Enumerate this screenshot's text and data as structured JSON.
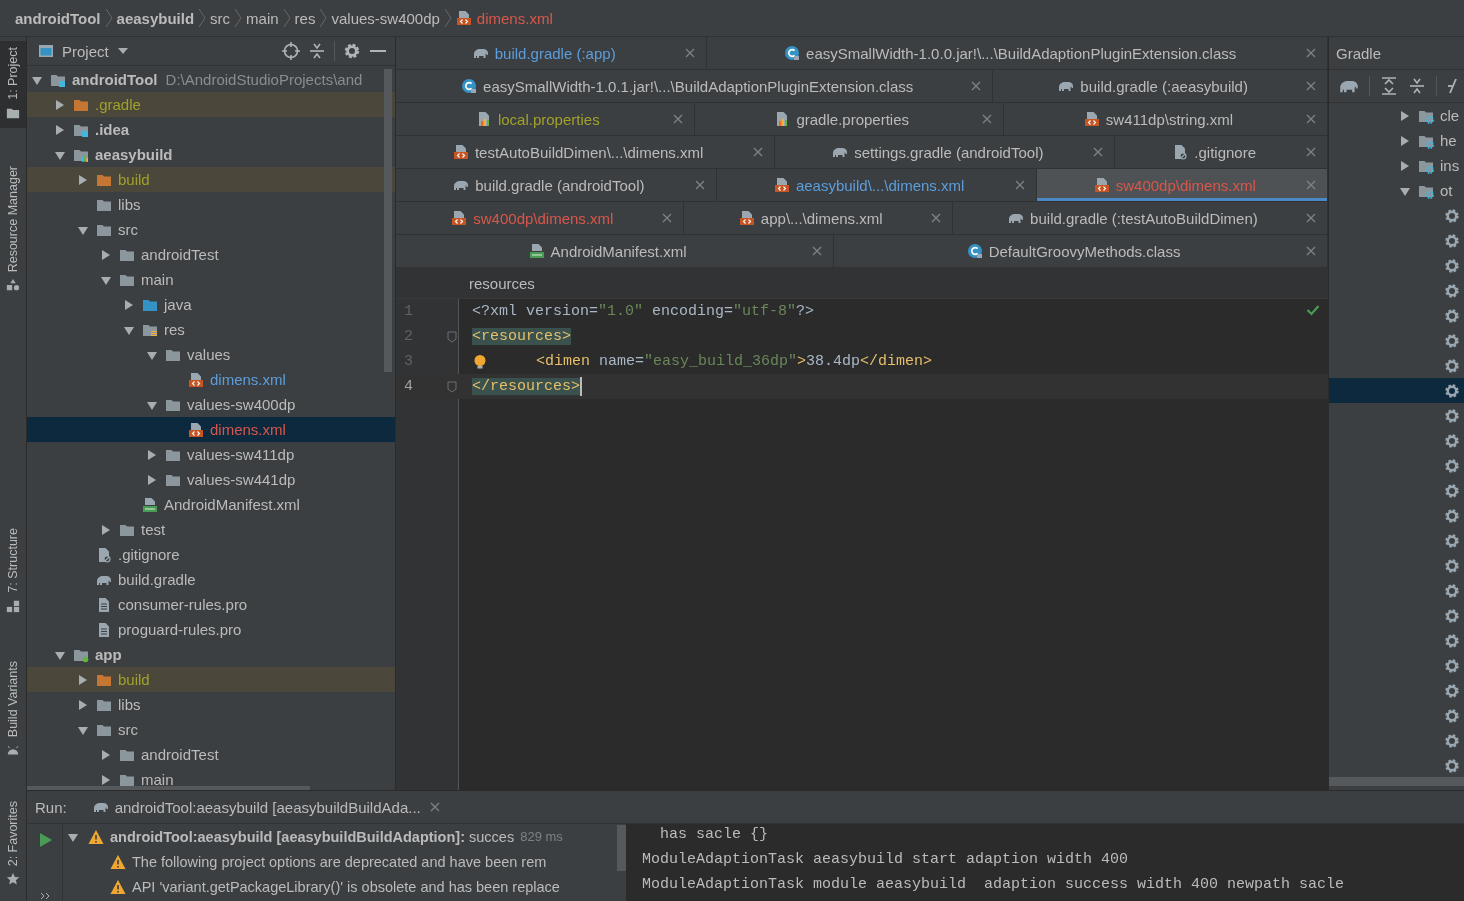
{
  "breadcrumbs": [
    {
      "label": "androidTool",
      "kind": "module"
    },
    {
      "label": "aeasybuild",
      "kind": "module"
    },
    {
      "label": "src",
      "kind": "folder"
    },
    {
      "label": "main",
      "kind": "folder"
    },
    {
      "label": "res",
      "kind": "folder"
    },
    {
      "label": "values-sw400dp",
      "kind": "folder"
    },
    {
      "label": "dimens.xml",
      "kind": "xml",
      "color": "#d8574c"
    }
  ],
  "tool_strip": [
    {
      "label": "1: Project",
      "kind": "project",
      "selected": true
    },
    {
      "label": "Resource Manager",
      "kind": "resources",
      "selected": false
    },
    {
      "label": "7: Structure",
      "kind": "structure",
      "selected": false
    },
    {
      "label": "Build Variants",
      "kind": "variants",
      "selected": false
    },
    {
      "label": "2: Favorites",
      "kind": "favorites",
      "selected": false
    }
  ],
  "project": {
    "title": "Project",
    "tree": [
      {
        "label": "androidTool",
        "path": "D:\\AndroidStudioProjects\\and",
        "kind": "module",
        "expanded": true,
        "selected": false,
        "excluded": false,
        "children": [
          {
            "label": ".gradle",
            "kind": "excluded-folder",
            "expanded": false,
            "selected": false,
            "excluded": true,
            "color": "#a1a12b"
          },
          {
            "label": ".idea",
            "kind": "module",
            "expanded": false,
            "selected": false,
            "excluded": false
          },
          {
            "label": "aeasybuild",
            "kind": "library-module",
            "expanded": true,
            "selected": false,
            "excluded": false,
            "children": [
              {
                "label": "build",
                "kind": "excluded-folder",
                "expanded": false,
                "selected": false,
                "excluded": true,
                "color": "#a1a12b"
              },
              {
                "label": "libs",
                "kind": "folder",
                "selected": false,
                "excluded": false
              },
              {
                "label": "src",
                "kind": "folder",
                "expanded": true,
                "selected": false,
                "excluded": false,
                "children": [
                  {
                    "label": "androidTest",
                    "kind": "folder",
                    "expanded": false,
                    "selected": false,
                    "excluded": false
                  },
                  {
                    "label": "main",
                    "kind": "folder",
                    "expanded": true,
                    "selected": false,
                    "excluded": false,
                    "children": [
                      {
                        "label": "java",
                        "kind": "source-folder",
                        "expanded": false,
                        "selected": false,
                        "excluded": false
                      },
                      {
                        "label": "res",
                        "kind": "res-folder",
                        "expanded": true,
                        "selected": false,
                        "excluded": false,
                        "children": [
                          {
                            "label": "values",
                            "kind": "folder",
                            "expanded": true,
                            "selected": false,
                            "excluded": false,
                            "children": [
                              {
                                "label": "dimens.xml",
                                "kind": "xml",
                                "selected": false,
                                "excluded": false,
                                "color": "#5c9ddb"
                              }
                            ]
                          },
                          {
                            "label": "values-sw400dp",
                            "kind": "folder",
                            "expanded": true,
                            "selected": false,
                            "excluded": false,
                            "children": [
                              {
                                "label": "dimens.xml",
                                "kind": "xml",
                                "selected": true,
                                "excluded": false,
                                "color": "#d8574c"
                              }
                            ]
                          },
                          {
                            "label": "values-sw411dp",
                            "kind": "folder",
                            "expanded": false,
                            "selected": false,
                            "excluded": false
                          },
                          {
                            "label": "values-sw441dp",
                            "kind": "folder",
                            "expanded": false,
                            "selected": false,
                            "excluded": false
                          }
                        ]
                      },
                      {
                        "label": "AndroidManifest.xml",
                        "kind": "manifest",
                        "selected": false,
                        "excluded": false
                      }
                    ]
                  },
                  {
                    "label": "test",
                    "kind": "folder",
                    "expanded": false,
                    "selected": false,
                    "excluded": false
                  }
                ]
              },
              {
                "label": ".gitignore",
                "kind": "gitignore",
                "selected": false,
                "excluded": false
              },
              {
                "label": "build.gradle",
                "kind": "gradle",
                "selected": false,
                "excluded": false
              },
              {
                "label": "consumer-rules.pro",
                "kind": "text",
                "selected": false,
                "excluded": false
              },
              {
                "label": "proguard-rules.pro",
                "kind": "text",
                "selected": false,
                "excluded": false
              }
            ]
          },
          {
            "label": "app",
            "kind": "app-module",
            "expanded": true,
            "selected": false,
            "excluded": false,
            "children": [
              {
                "label": "build",
                "kind": "excluded-folder",
                "expanded": false,
                "selected": false,
                "excluded": true,
                "color": "#a1a12b"
              },
              {
                "label": "libs",
                "kind": "folder",
                "expanded": false,
                "selected": false,
                "excluded": false
              },
              {
                "label": "src",
                "kind": "folder",
                "expanded": true,
                "selected": false,
                "excluded": false,
                "children": [
                  {
                    "label": "androidTest",
                    "kind": "folder",
                    "expanded": false,
                    "selected": false,
                    "excluded": false
                  },
                  {
                    "label": "main",
                    "kind": "folder",
                    "expanded": false,
                    "selected": false,
                    "excluded": false
                  }
                ]
              }
            ]
          }
        ]
      }
    ]
  },
  "editor": {
    "tab_rows": [
      {
        "tabs": [
          {
            "label": "build.gradle (:app)",
            "kind": "gradle",
            "selected": false,
            "color": "#5c9ddb"
          },
          {
            "label": "easySmallWidth-1.0.0.jar!\\...\\BuildAdaptionPluginExtension.class",
            "kind": "class",
            "selected": false
          }
        ]
      },
      {
        "tabs": [
          {
            "label": "easySmallWidth-1.0.1.jar!\\...\\BuildAdaptionPluginExtension.class",
            "kind": "class",
            "selected": false
          },
          {
            "label": "build.gradle (:aeasybuild)",
            "kind": "gradle",
            "selected": false
          }
        ]
      },
      {
        "tabs": [
          {
            "label": "local.properties",
            "kind": "properties",
            "selected": false,
            "color": "#a1a12b"
          },
          {
            "label": "gradle.properties",
            "kind": "properties",
            "selected": false
          },
          {
            "label": "sw411dp\\string.xml",
            "kind": "xml",
            "selected": false
          }
        ]
      },
      {
        "tabs": [
          {
            "label": "testAutoBuildDimen\\...\\dimens.xml",
            "kind": "xml",
            "selected": false
          },
          {
            "label": "settings.gradle (androidTool)",
            "kind": "gradle",
            "selected": false
          },
          {
            "label": ".gitignore",
            "kind": "gitignore",
            "selected": false
          }
        ]
      },
      {
        "tabs": [
          {
            "label": "build.gradle (androidTool)",
            "kind": "gradle",
            "selected": false
          },
          {
            "label": "aeasybuild\\...\\dimens.xml",
            "kind": "xml",
            "selected": false,
            "color": "#5c9ddb"
          },
          {
            "label": "sw400dp\\dimens.xml",
            "kind": "xml",
            "selected": true,
            "color": "#d8574c"
          }
        ]
      },
      {
        "tabs": [
          {
            "label": "sw400dp\\dimens.xml",
            "kind": "xml",
            "selected": false,
            "color": "#d8574c"
          },
          {
            "label": "app\\...\\dimens.xml",
            "kind": "xml",
            "selected": false
          },
          {
            "label": "build.gradle (:testAutoBuildDimen)",
            "kind": "gradle",
            "selected": false
          }
        ]
      },
      {
        "tabs": [
          {
            "label": "AndroidManifest.xml",
            "kind": "manifest",
            "selected": false
          },
          {
            "label": "DefaultGroovyMethods.class",
            "kind": "class",
            "selected": false
          }
        ]
      }
    ],
    "breadcrumb": "resources",
    "lines": [
      {
        "number": "1",
        "current": false,
        "bulb": false,
        "fold": false,
        "tokens": [
          {
            "text": "<?xml version=",
            "kind": "plain"
          },
          {
            "text": "\"1.0\"",
            "kind": "string"
          },
          {
            "text": " encoding=",
            "kind": "plain"
          },
          {
            "text": "\"utf-8\"",
            "kind": "string"
          },
          {
            "text": "?>",
            "kind": "plain"
          }
        ]
      },
      {
        "number": "2",
        "current": false,
        "bulb": false,
        "fold": true,
        "tokens": [
          {
            "text": "<resources>",
            "kind": "match"
          }
        ]
      },
      {
        "number": "3",
        "current": false,
        "bulb": true,
        "fold": false,
        "tokens": [
          {
            "text": "        <dimen",
            "kind": "tag"
          },
          {
            "text": " name=",
            "kind": "plain"
          },
          {
            "text": "\"easy_build_36dp\"",
            "kind": "string"
          },
          {
            "text": ">",
            "kind": "tag"
          },
          {
            "text": "38.4dp",
            "kind": "plain"
          },
          {
            "text": "</dimen>",
            "kind": "tag"
          }
        ]
      },
      {
        "number": "4",
        "current": true,
        "bulb": false,
        "fold": true,
        "tokens": [
          {
            "text": "</resources>",
            "kind": "match"
          }
        ]
      }
    ]
  },
  "gradle": {
    "title": "Gradle",
    "tree": [
      {
        "label": "cle",
        "kind": "group",
        "expanded": false,
        "selected": false
      },
      {
        "label": "he",
        "kind": "group",
        "expanded": false,
        "selected": false
      },
      {
        "label": "ins",
        "kind": "group",
        "expanded": false,
        "selected": false
      },
      {
        "label": "ot",
        "kind": "group",
        "expanded": true,
        "selected": false,
        "children": [
          {
            "kind": "task",
            "selected": false
          },
          {
            "kind": "task",
            "selected": false
          },
          {
            "kind": "task",
            "selected": false
          },
          {
            "kind": "task",
            "selected": false
          },
          {
            "kind": "task",
            "selected": false
          },
          {
            "kind": "task",
            "selected": false
          },
          {
            "kind": "task",
            "selected": false
          },
          {
            "kind": "task",
            "selected": true
          },
          {
            "kind": "task",
            "selected": false
          },
          {
            "kind": "task",
            "selected": false
          },
          {
            "kind": "task",
            "selected": false
          },
          {
            "kind": "task",
            "selected": false
          },
          {
            "kind": "task",
            "selected": false
          },
          {
            "kind": "task",
            "selected": false
          },
          {
            "kind": "task",
            "selected": false
          },
          {
            "kind": "task",
            "selected": false
          },
          {
            "kind": "task",
            "selected": false
          },
          {
            "kind": "task",
            "selected": false
          },
          {
            "kind": "task",
            "selected": false
          },
          {
            "kind": "task",
            "selected": false
          },
          {
            "kind": "task",
            "selected": false
          },
          {
            "kind": "task",
            "selected": false
          },
          {
            "kind": "task",
            "selected": false
          }
        ]
      }
    ]
  },
  "run": {
    "title": "Run:",
    "tab": "androidTool:aeasybuild [aeasybuildBuildAda...",
    "tree": [
      {
        "text": "**androidTool:aeasybuild [aeasybuildBuildAdaption]:** succes",
        "time": "829 ms",
        "kind": "warning",
        "expanded": true,
        "children": [
          {
            "text": "The following project options are deprecated and have been rem",
            "kind": "warning"
          },
          {
            "text": "API 'variant.getPackageLibrary()' is obsolete and has been replace",
            "kind": "warning"
          }
        ]
      }
    ],
    "console": [
      "  has sacle {}",
      "ModuleAdaptionTask aeasybuild start adaption width 400",
      "ModuleAdaptionTask module aeasybuild  adaption success width 400 newpath sacle"
    ]
  }
}
